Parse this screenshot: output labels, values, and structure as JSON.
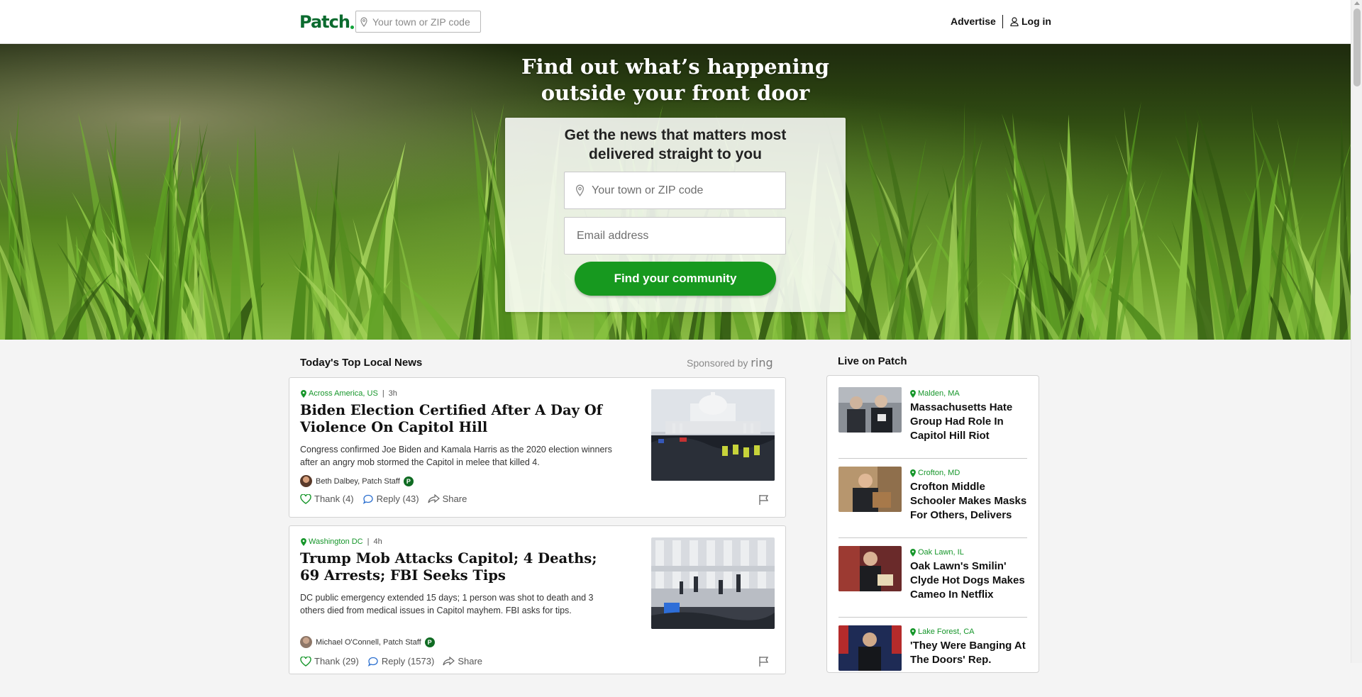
{
  "header": {
    "logo": "Patch",
    "search_placeholder": "Your town or ZIP code",
    "advertise": "Advertise",
    "login": "Log in"
  },
  "hero": {
    "title_line1": "Find out what’s happening",
    "title_line2": "outside your front door",
    "card_line1": "Get the news that matters most",
    "card_line2": "delivered straight to you",
    "town_placeholder": "Your town or ZIP code",
    "email_placeholder": "Email address",
    "cta": "Find your community"
  },
  "main": {
    "section_title": "Today's Top Local News",
    "sponsored_by": "Sponsored by",
    "sponsor": "ring",
    "articles": [
      {
        "location": "Across America, US",
        "time": "3h",
        "title": "Biden Election Certified After A Day Of Violence On Capitol Hill",
        "description": "Congress confirmed Joe Biden and Kamala Harris as the 2020 election winners after an angry mob stormed the Capitol in melee that killed 4.",
        "author": "Beth Dalbey, Patch Staff",
        "thank": "Thank (4)",
        "reply": "Reply (43)",
        "share": "Share"
      },
      {
        "location": "Washington DC",
        "time": "4h",
        "title": "Trump Mob Attacks Capitol; 4 Deaths; 69 Arrests; FBI Seeks Tips",
        "description": "DC public emergency extended 15 days; 1 person was shot to death and 3 others died from medical issues in Capitol mayhem. FBI asks for tips.",
        "author": "Michael O'Connell, Patch Staff",
        "thank": "Thank (29)",
        "reply": "Reply (1573)",
        "share": "Share"
      }
    ]
  },
  "live": {
    "title": "Live on Patch",
    "items": [
      {
        "location": "Malden, MA",
        "title": "Massachusetts Hate Group Had Role In Capitol Hill Riot"
      },
      {
        "location": "Crofton, MD",
        "title": "Crofton Middle Schooler Makes Masks For Others, Delivers"
      },
      {
        "location": "Oak Lawn, IL",
        "title": "Oak Lawn's Smilin' Clyde Hot Dogs Makes Cameo In Netflix"
      },
      {
        "location": "Lake Forest, CA",
        "title": "'They Were Banging At The Doors' Rep."
      }
    ]
  },
  "staff_badge": "P",
  "colors": {
    "brand": "#0b6b2f",
    "accent": "#17991f",
    "location": "#16962a"
  }
}
